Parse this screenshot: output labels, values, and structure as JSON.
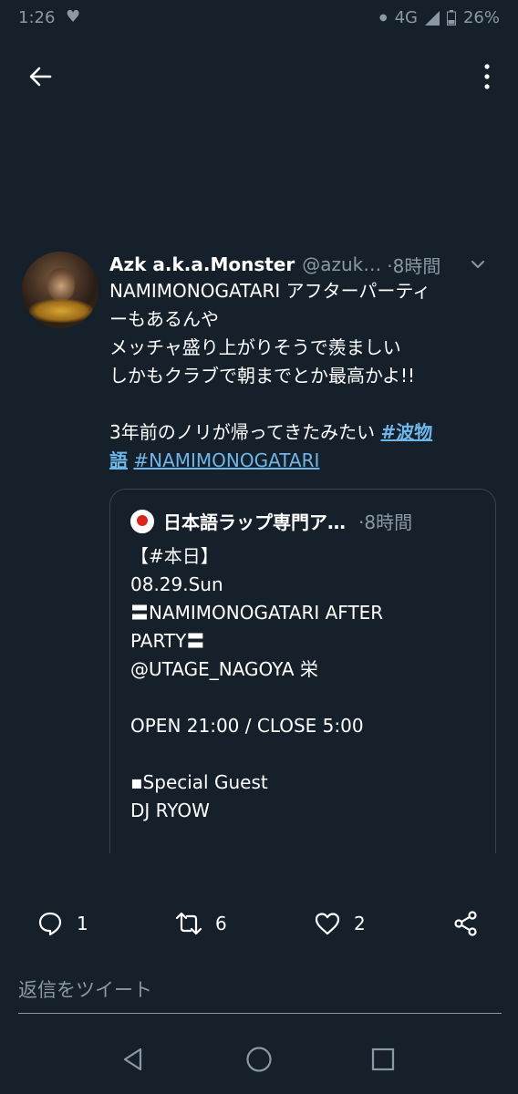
{
  "status_bar": {
    "time": "1:26",
    "network": "4G",
    "battery": "26%"
  },
  "colors": {
    "background": "#15202b",
    "secondary_text": "#8b98a5",
    "link": "#6fb6ea",
    "border": "#38444d"
  },
  "tweet": {
    "display_name": "Azk a.k.a.Monster",
    "handle": "@azuk…",
    "time": "·8時間",
    "lines": [
      "NAMIMONOGATARI アフターパーティ",
      "ーもあるんや",
      "メッチャ盛り上がりそうで羨ましい",
      "しかもクラブで朝までとか最高かよ!!",
      "",
      "3年前のノリが帰ってきたみたい "
    ],
    "hashtag_1_part_a": "#波物",
    "hashtag_1_part_b": "語",
    "hashtag_2": "#NAMIMONOGATARI"
  },
  "quote": {
    "author": "日本語ラップ専門ア…",
    "time": "·8時間",
    "lines": [
      "【#本日】",
      "08.29.Sun",
      "〓NAMIMONOGATARI AFTER",
      "PARTY〓",
      "@UTAGE_NAGOYA 栄",
      "",
      "OPEN 21:00 / CLOSE 5:00",
      "",
      "▪︎Special Guest",
      "DJ RYOW"
    ]
  },
  "actions": {
    "reply_count": "1",
    "retweet_count": "6",
    "like_count": "2"
  },
  "reply_box": {
    "placeholder": "返信をツイート"
  }
}
